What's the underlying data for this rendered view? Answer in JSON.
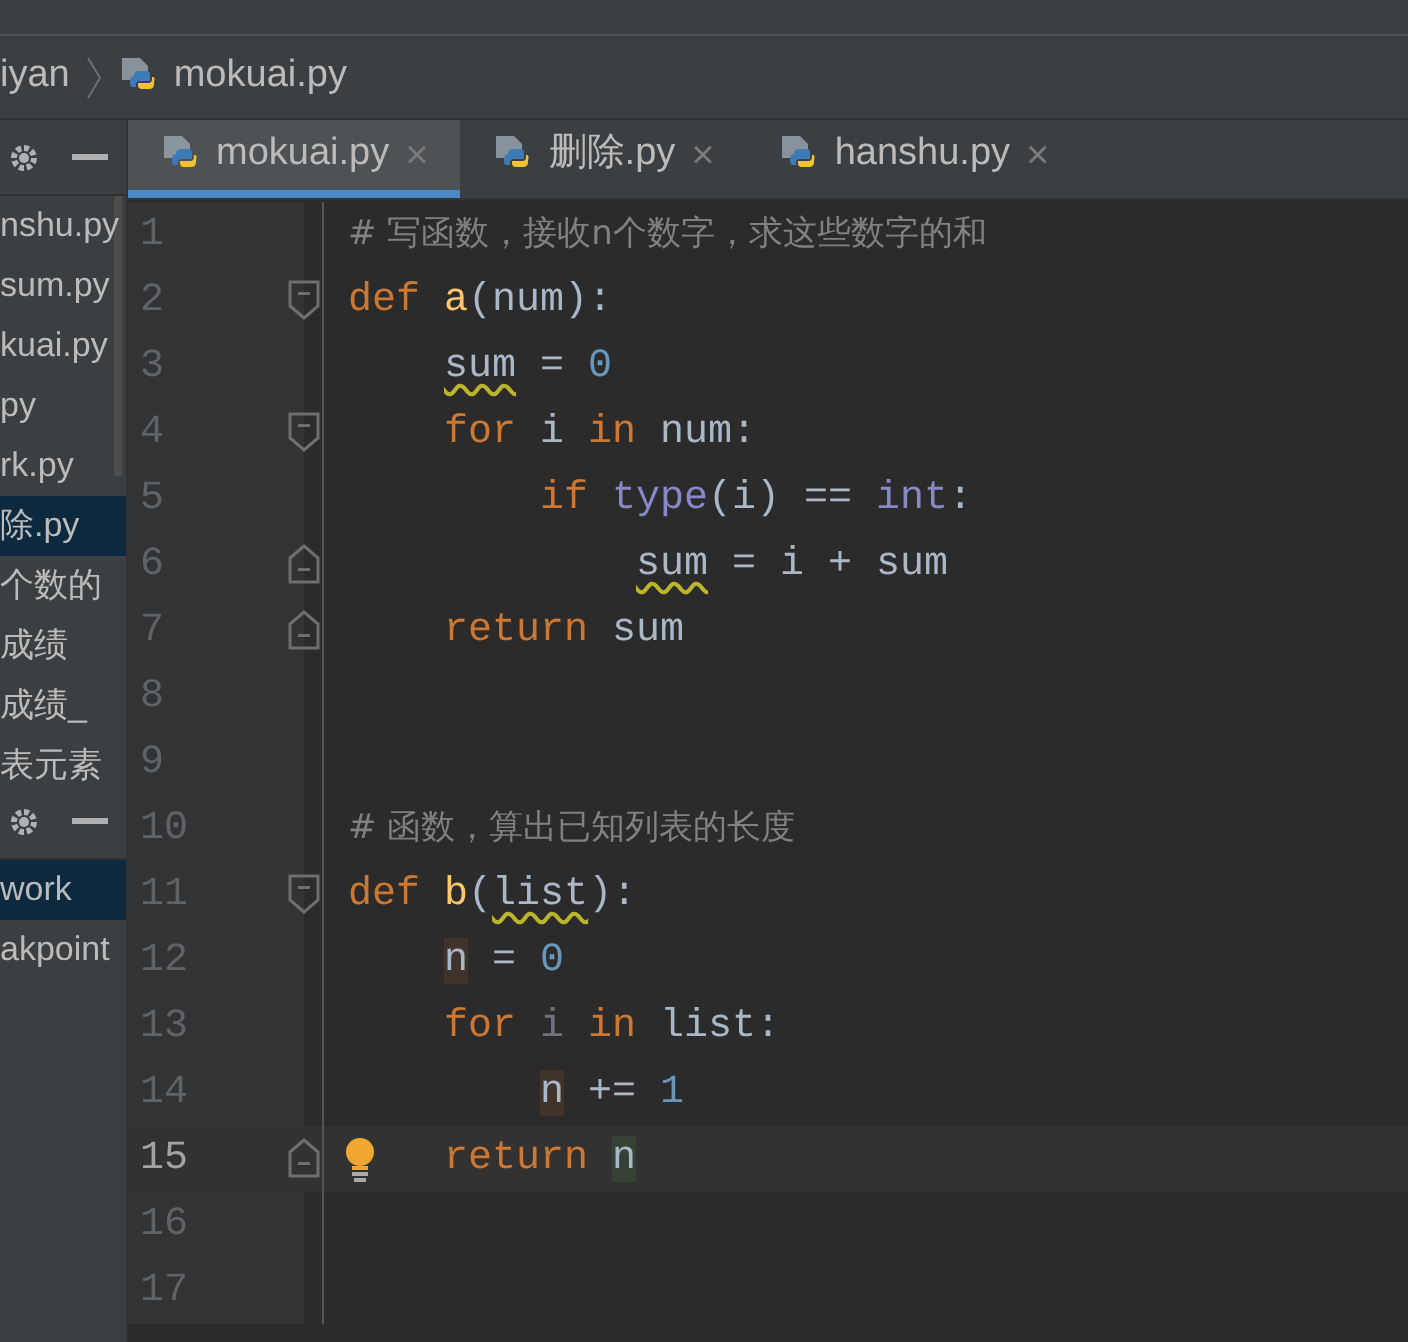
{
  "breadcrumb": [
    {
      "label": "iyan",
      "kind": "folder"
    },
    {
      "label": "mokuai.py",
      "kind": "python-file"
    }
  ],
  "project_panel": {
    "items": [
      {
        "label": "nshu.py",
        "selected": false
      },
      {
        "label": "sum.py",
        "selected": false
      },
      {
        "label": "kuai.py",
        "selected": false
      },
      {
        "label": "py",
        "selected": false
      },
      {
        "label": "rk.py",
        "selected": false
      },
      {
        "label": "除.py",
        "selected": true
      },
      {
        "label": "个数的",
        "selected": false
      },
      {
        "label": "成绩",
        "selected": false
      },
      {
        "label": "成绩_",
        "selected": false
      },
      {
        "label": "表元素",
        "selected": false
      }
    ]
  },
  "debug_panel": {
    "items": [
      {
        "label": "work",
        "selected": true
      },
      {
        "label": "akpoint",
        "selected": false
      }
    ]
  },
  "tabs": [
    {
      "label": "mokuai.py",
      "selected": true,
      "close": "×"
    },
    {
      "label": "删除.py",
      "selected": false,
      "close": "×"
    },
    {
      "label": "hanshu.py",
      "selected": false,
      "close": "×"
    }
  ],
  "editor": {
    "lines": [
      {
        "number": "1",
        "current": false,
        "tokens": [
          {
            "kind": "comment",
            "text": "# 写函数，接收n个数字，求这些数字的和"
          }
        ]
      },
      {
        "number": "2",
        "current": false,
        "kind": "fold-start",
        "tokens": [
          {
            "kind": "keyword",
            "text": "def "
          },
          {
            "kind": "func",
            "text": "a"
          },
          {
            "kind": "plain",
            "text": "(num):"
          }
        ],
        "children": [
          {
            "number": "3",
            "current": false,
            "tokens": [
              {
                "kind": "warning",
                "text": "sum"
              },
              {
                "kind": "plain",
                "text": " = "
              },
              {
                "kind": "number",
                "text": "0"
              }
            ]
          },
          {
            "number": "4",
            "current": false,
            "kind": "fold-start",
            "tokens": [
              {
                "kind": "keyword",
                "text": "for "
              },
              {
                "kind": "plain",
                "text": "i "
              },
              {
                "kind": "keyword",
                "text": "in "
              },
              {
                "kind": "plain",
                "text": "num:"
              }
            ],
            "children": [
              {
                "number": "5",
                "current": false,
                "tokens": [
                  {
                    "kind": "keyword",
                    "text": "if "
                  },
                  {
                    "kind": "builtin",
                    "text": "type"
                  },
                  {
                    "kind": "plain",
                    "text": "(i) == "
                  },
                  {
                    "kind": "builtin",
                    "text": "int"
                  },
                  {
                    "kind": "plain",
                    "text": ":"
                  }
                ],
                "children": [
                  {
                    "number": "6",
                    "current": false,
                    "kind": "fold-end",
                    "tokens": [
                      {
                        "kind": "warning",
                        "text": "sum"
                      },
                      {
                        "kind": "plain",
                        "text": " = i + sum"
                      }
                    ]
                  }
                ]
              }
            ]
          },
          {
            "number": "7",
            "current": false,
            "kind": "fold-end",
            "tokens": [
              {
                "kind": "keyword",
                "text": "return "
              },
              {
                "kind": "plain",
                "text": "sum"
              }
            ]
          }
        ]
      },
      {
        "number": "8",
        "current": false
      },
      {
        "number": "9",
        "current": false
      },
      {
        "number": "10",
        "current": false,
        "tokens": [
          {
            "kind": "comment",
            "text": "# 函数，算出已知列表的长度"
          }
        ]
      },
      {
        "number": "11",
        "current": false,
        "kind": "fold-start",
        "tokens": [
          {
            "kind": "keyword",
            "text": "def "
          },
          {
            "kind": "func",
            "text": "b"
          },
          {
            "kind": "plain",
            "text": "("
          },
          {
            "kind": "warning",
            "text": "list"
          },
          {
            "kind": "plain",
            "text": "):"
          }
        ],
        "children": [
          {
            "number": "12",
            "current": false,
            "tokens": [
              {
                "kind": "usage",
                "text": "n"
              },
              {
                "kind": "plain",
                "text": " = "
              },
              {
                "kind": "number",
                "text": "0"
              }
            ]
          },
          {
            "number": "13",
            "current": false,
            "tokens": [
              {
                "kind": "keyword",
                "text": "for "
              },
              {
                "kind": "dim",
                "text": "i "
              },
              {
                "kind": "keyword",
                "text": "in "
              },
              {
                "kind": "plain",
                "text": "list:"
              }
            ],
            "children": [
              {
                "number": "14",
                "current": false,
                "tokens": [
                  {
                    "kind": "usage",
                    "text": "n"
                  },
                  {
                    "kind": "plain",
                    "text": " += "
                  },
                  {
                    "kind": "number",
                    "text": "1"
                  }
                ]
              }
            ]
          },
          {
            "number": "15",
            "current": true,
            "kind": "bulb-fold-end",
            "tokens": [
              {
                "kind": "keyword",
                "text": "return "
              },
              {
                "kind": "caret-usage",
                "text": "n"
              }
            ]
          }
        ]
      },
      {
        "number": "16",
        "current": false
      },
      {
        "number": "17",
        "current": false
      }
    ]
  }
}
